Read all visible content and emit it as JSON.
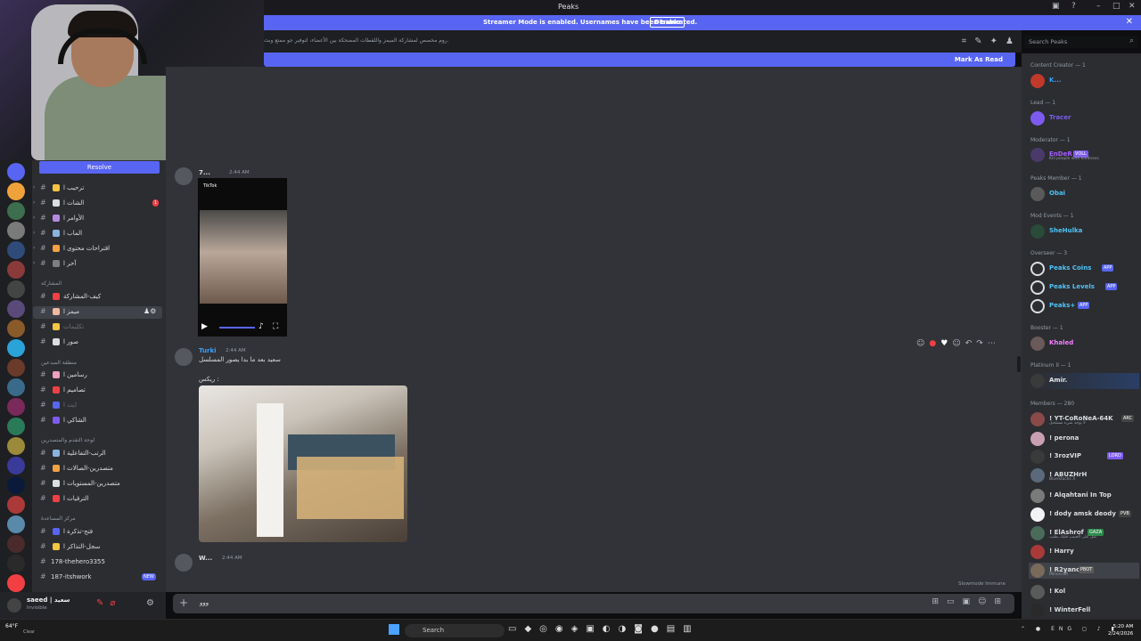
{
  "window": {
    "title": "Peaks"
  },
  "streamer": {
    "message": "Streamer Mode is enabled. Usernames have been truncated.",
    "disable_label": "Disable"
  },
  "channel_header": {
    "topic": "روم مخصص لمشاركة الميمز واللقطات المضحكة بين الأعضاء، لتوفير جو ممتع وبث.",
    "search_placeholder": "Search Peaks"
  },
  "mark_read": {
    "label": "Mark As Read"
  },
  "resolve": {
    "label": "Resolve"
  },
  "channels": [
    {
      "label": "ترحيب ا",
      "unread": false
    },
    {
      "label": "الشات ا",
      "unread": true,
      "badge": "1"
    },
    {
      "label": "الأوامر ا",
      "unread": false
    },
    {
      "label": "الماب ا",
      "unread": false
    },
    {
      "label": "اقتراحات محتوى ا",
      "unread": false
    },
    {
      "label": "آخر ا",
      "unread": false
    },
    {
      "label": "كيف-المشاركة",
      "unread": false
    },
    {
      "label": "ميمز ا",
      "unread": false
    },
    {
      "label": "تكليمات",
      "unread": false
    },
    {
      "label": "صور ا",
      "unread": false
    },
    {
      "label": "رسامين ا",
      "unread": false
    },
    {
      "label": "تصاميم ا",
      "unread": false
    },
    {
      "label": "ايت ا",
      "unread": false
    },
    {
      "label": "الشاكي ا",
      "unread": false
    },
    {
      "label": "الرتب-التفاعلية ا",
      "unread": false
    },
    {
      "label": "متصدرين-الصالات ا",
      "unread": false
    },
    {
      "label": "متصدرين-المستويات ا",
      "unread": false
    },
    {
      "label": "الترقيات ا",
      "unread": false
    },
    {
      "label": "فتح-تذكرة ا",
      "unread": false
    },
    {
      "label": "سجل-التذاكر ا",
      "unread": false
    },
    {
      "label": "178-thehero3355",
      "unread": false
    },
    {
      "label": "187-itshwork",
      "unread": false,
      "badge": "NEW"
    }
  ],
  "categories": [
    "المشاركة",
    "منطقة المبدعين",
    "لوحة التقدم والمتصدرين",
    "مركز المساعدة"
  ],
  "user": {
    "name": "saeed | سعيد",
    "status": "Invisible"
  },
  "messages": [
    {
      "author": "7...",
      "time": "2:44 AM",
      "embed_source": "TikTok"
    },
    {
      "author": "Turki",
      "time": "2:44 AM",
      "text": "سعيد بعد ما بدا يصور المسلسل",
      "text2": "ريكس :"
    },
    {
      "author": "W...",
      "time": "2:44 AM"
    }
  ],
  "slowmode": "Slowmode Immune",
  "composer": {
    "value": "ووو"
  },
  "member_groups": [
    {
      "title": "Content Creator — 1",
      "members": [
        {
          "name": "K...",
          "color": "#3ba0ff"
        }
      ]
    },
    {
      "title": "Lead — 1",
      "members": [
        {
          "name": "Tracer",
          "color": "#7e5bef"
        }
      ]
    },
    {
      "title": "Moderator — 1",
      "members": [
        {
          "name": "EnDeR",
          "color": "#a45bff",
          "tag": "VOLL",
          "sub": "Kill people with kindness"
        }
      ]
    },
    {
      "title": "Peaks Member — 1",
      "members": [
        {
          "name": "Obai",
          "color": "#4fc3f7"
        }
      ]
    },
    {
      "title": "Mod Events — 1",
      "members": [
        {
          "name": "SheHulka",
          "color": "#4fc3f7"
        }
      ]
    },
    {
      "title": "Overseer — 3",
      "members": [
        {
          "name": "Peaks Coins",
          "color": "#4fc3f7",
          "tag": "APP"
        },
        {
          "name": "Peaks Levels",
          "color": "#4fc3f7",
          "tag": "APP"
        },
        {
          "name": "Peaks+",
          "color": "#4fc3f7",
          "tag": "APP"
        }
      ]
    },
    {
      "title": "Booster — 1",
      "members": [
        {
          "name": "Khaled",
          "color": "#f47fff"
        }
      ]
    },
    {
      "title": "Platinum II — 1",
      "members": [
        {
          "name": "Amir.",
          "color": "#e3e5e8"
        }
      ]
    },
    {
      "title": "Members — 280",
      "members": [
        {
          "name": "! YT-CoRoNeA-64K",
          "color": "#dbdee1",
          "tag": "ARC",
          "sub": "لا يوجد شيء مستحيل"
        },
        {
          "name": "! perona",
          "color": "#dbdee1"
        },
        {
          "name": "! 3rozVIP",
          "color": "#dbdee1",
          "tag": "LORD"
        },
        {
          "name": "! ABUZHrH",
          "color": "#dbdee1",
          "sub": "BlueStacks X"
        },
        {
          "name": "! Alqahtani In Top",
          "color": "#dbdee1"
        },
        {
          "name": "! dody amsk deody",
          "color": "#dbdee1",
          "tag": "PVB"
        },
        {
          "name": "! ElAshrof",
          "color": "#dbdee1",
          "tag": "GAZA",
          "sub": "صل على الحبيب قلبك يطيب"
        },
        {
          "name": "! Harry",
          "color": "#dbdee1"
        },
        {
          "name": "! R2yanc",
          "color": "#dbdee1",
          "tag": "PBOT",
          "sub": "Minecraft"
        },
        {
          "name": "! Kol",
          "color": "#dbdee1"
        },
        {
          "name": "! WinterFell",
          "color": "#dbdee1"
        }
      ]
    }
  ],
  "taskbar": {
    "weather_temp": "64°F",
    "weather_desc": "Clear",
    "search": "Search",
    "lang": "ENG",
    "time": "5:20 AM",
    "date": "2/24/2026"
  },
  "colors": {
    "accent": "#5865f2",
    "danger": "#f23f43",
    "bg_chat": "#313338",
    "bg_side": "#2b2d31"
  }
}
